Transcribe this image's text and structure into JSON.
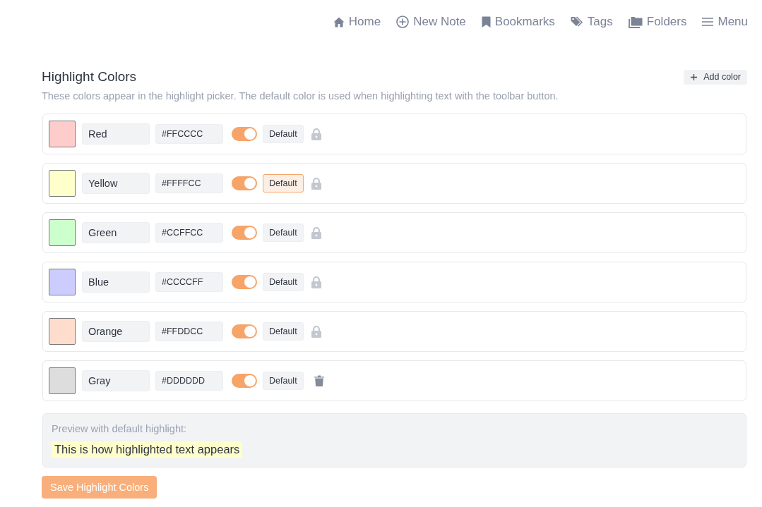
{
  "nav": [
    {
      "label": "Home"
    },
    {
      "label": "New Note"
    },
    {
      "label": "Bookmarks"
    },
    {
      "label": "Tags"
    },
    {
      "label": "Folders"
    },
    {
      "label": "Menu"
    }
  ],
  "section": {
    "title": "Highlight Colors",
    "description": "These colors appear in the highlight picker. The default color is used when highlighting text with the toolbar button.",
    "add_button": "Add color"
  },
  "colors": [
    {
      "name": "Red",
      "hex": "#FFCCCC",
      "color": "#ffcccc",
      "on": true,
      "default_button": "Default",
      "selected": false,
      "kind": "locked"
    },
    {
      "name": "Yellow",
      "hex": "#FFFFCC",
      "color": "#ffffcc",
      "on": true,
      "default_button": "Default",
      "selected": true,
      "kind": "locked"
    },
    {
      "name": "Green",
      "hex": "#CCFFCC",
      "color": "#ccffcc",
      "on": true,
      "default_button": "Default",
      "selected": false,
      "kind": "locked"
    },
    {
      "name": "Blue",
      "hex": "#CCCCFF",
      "color": "#ccccff",
      "on": true,
      "default_button": "Default",
      "selected": false,
      "kind": "locked"
    },
    {
      "name": "Orange",
      "hex": "#FFDDCC",
      "color": "#ffddcc",
      "on": true,
      "default_button": "Default",
      "selected": false,
      "kind": "locked"
    },
    {
      "name": "Gray",
      "hex": "#DDDDDD",
      "color": "#dddddd",
      "on": true,
      "default_button": "Default",
      "selected": false,
      "kind": "custom"
    }
  ],
  "preview": {
    "label": "Preview with default highlight:",
    "sample": "This is how highlighted text appears"
  },
  "save_button": "Save Highlight Colors"
}
